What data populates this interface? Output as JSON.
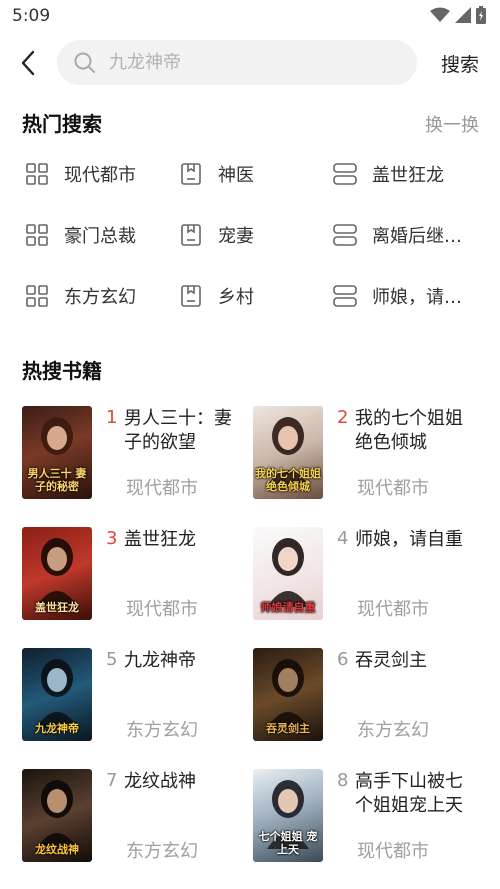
{
  "status": {
    "time": "5:09"
  },
  "search": {
    "placeholder": "九龙神帝",
    "button_label": "搜索"
  },
  "hot_search": {
    "title": "热门搜索",
    "refresh_label": "换一换",
    "items": [
      {
        "label": "现代都市",
        "icon": "grid-icon"
      },
      {
        "label": "神医",
        "icon": "book-icon"
      },
      {
        "label": "盖世狂龙",
        "icon": "list-icon"
      },
      {
        "label": "豪门总裁",
        "icon": "grid-icon"
      },
      {
        "label": "宠妻",
        "icon": "book-icon"
      },
      {
        "label": "离婚后继…",
        "icon": "list-icon"
      },
      {
        "label": "东方玄幻",
        "icon": "grid-icon"
      },
      {
        "label": "乡村",
        "icon": "book-icon"
      },
      {
        "label": "师娘，请…",
        "icon": "list-icon"
      }
    ]
  },
  "hot_books": {
    "title": "热搜书籍",
    "books": [
      {
        "rank": "1",
        "title": "男人三十：妻子的欲望",
        "category": "现代都市",
        "cover_text": "男人三十 妻子的秘密"
      },
      {
        "rank": "2",
        "title": "我的七个姐姐绝色倾城",
        "category": "现代都市",
        "cover_text": "我的七个姐姐 绝色倾城"
      },
      {
        "rank": "3",
        "title": "盖世狂龙",
        "category": "现代都市",
        "cover_text": "盖世狂龙"
      },
      {
        "rank": "4",
        "title": "师娘，请自重",
        "category": "现代都市",
        "cover_text": "师娘请自重"
      },
      {
        "rank": "5",
        "title": "九龙神帝",
        "category": "东方玄幻",
        "cover_text": "九龙神帝"
      },
      {
        "rank": "6",
        "title": "吞灵剑主",
        "category": "东方玄幻",
        "cover_text": "吞灵剑主"
      },
      {
        "rank": "7",
        "title": "龙纹战神",
        "category": "东方玄幻",
        "cover_text": "龙纹战神"
      },
      {
        "rank": "8",
        "title": "高手下山被七个姐姐宠上天",
        "category": "现代都市",
        "cover_text": "七个姐姐 宠上天"
      }
    ]
  },
  "colors": {
    "accent_rank": "#e04a3c",
    "muted": "#a0a0a0",
    "search_bg": "#f2f2f2"
  }
}
